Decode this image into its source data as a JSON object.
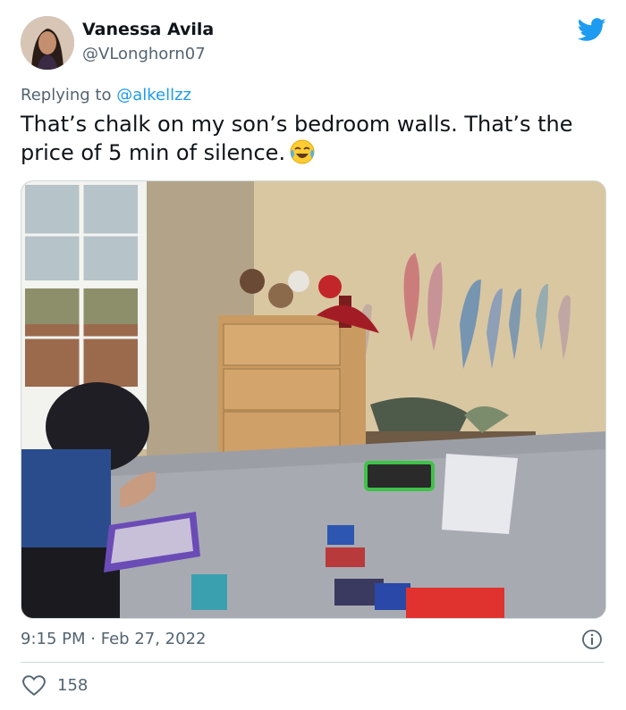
{
  "author": {
    "name": "Vanessa Avila",
    "handle": "@VLonghorn07",
    "avatar_icon": "profile-avatar"
  },
  "brand": {
    "icon": "twitter-bird-icon",
    "color": "#1d9bf0"
  },
  "reply": {
    "prefix": "Replying to",
    "mention": "@alkellzz"
  },
  "tweet": {
    "text": "That’s chalk on my son’s bedroom walls. That’s the price of 5 min of silence.",
    "emoji": "face-with-tears-of-joy"
  },
  "media": {
    "type": "photo"
  },
  "meta": {
    "time": "9:15 PM",
    "separator": "·",
    "date": "Feb 27, 2022",
    "info_icon": "info-icon"
  },
  "stats": {
    "likes": "158",
    "like_icon": "heart-icon"
  },
  "colors": {
    "text": "#0f1419",
    "secondary": "#536471",
    "link": "#1d9bf0",
    "border": "#cfd9de"
  }
}
